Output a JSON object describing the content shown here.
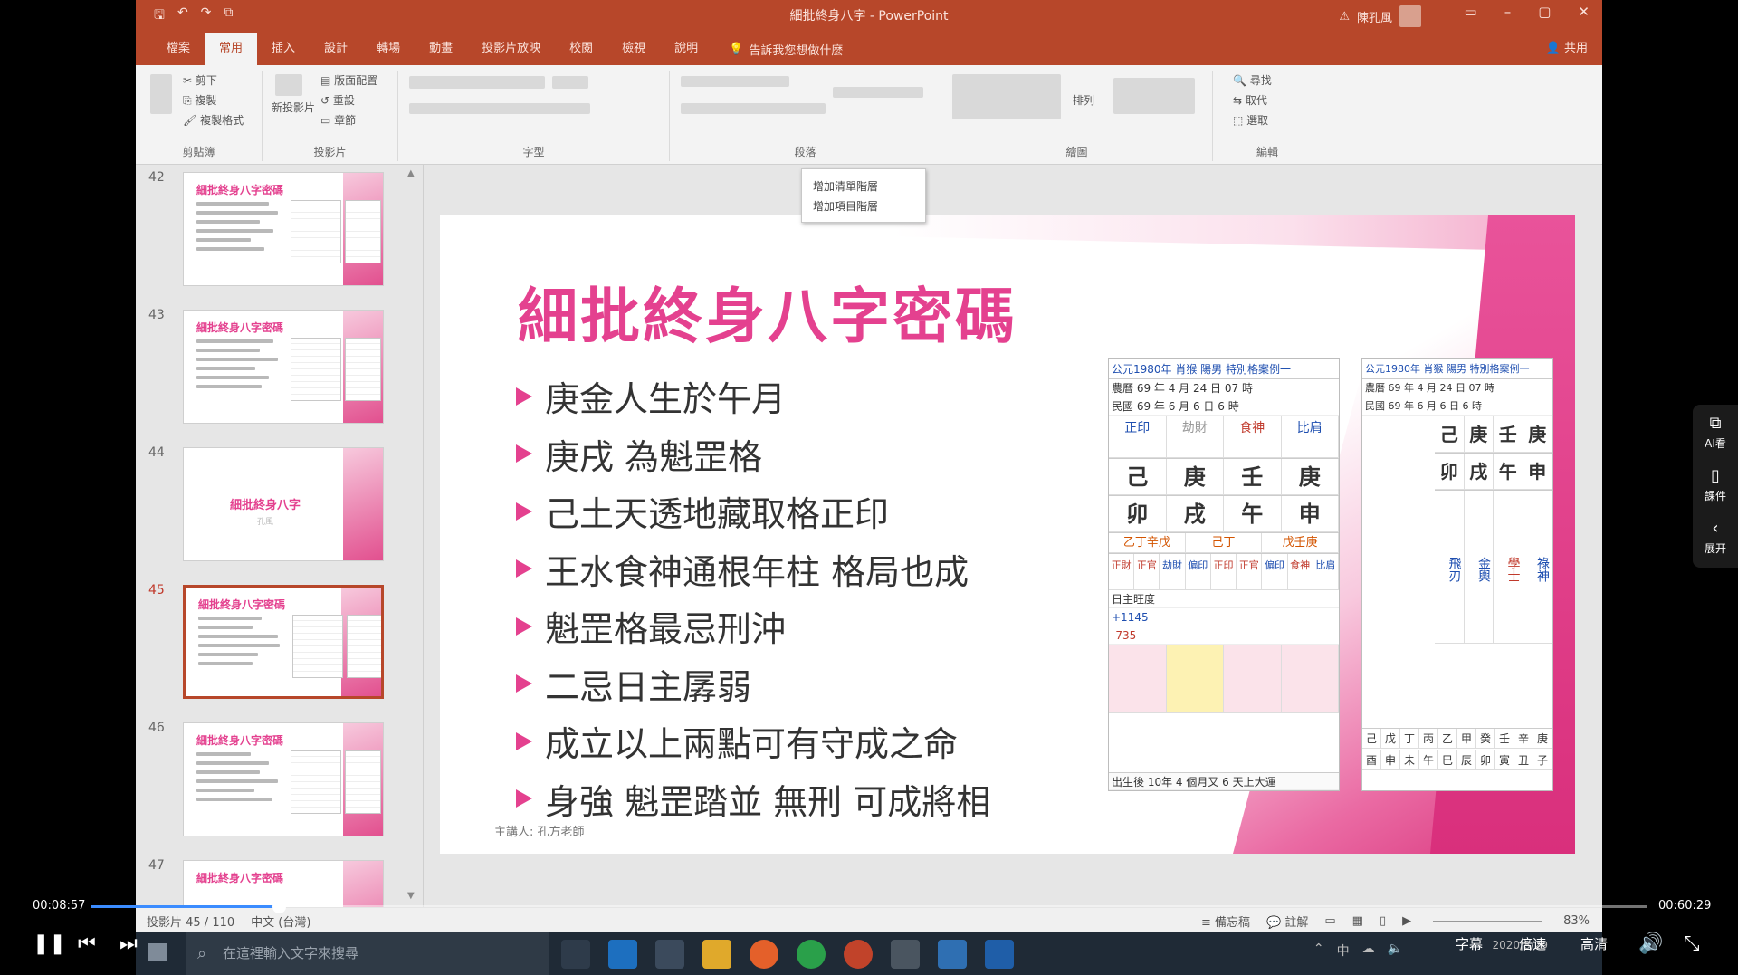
{
  "app": {
    "title": "細批終身八字 - PowerPoint",
    "user": "陳孔風",
    "share": "共用",
    "tell_me": "告訴我您想做什麼"
  },
  "tabs": [
    "檔案",
    "常用",
    "插入",
    "設計",
    "轉場",
    "動畫",
    "投影片放映",
    "校閱",
    "檢視",
    "說明"
  ],
  "ribbon": {
    "clipboard": {
      "label": "剪貼簿",
      "cut": "剪下",
      "copy": "複製",
      "format_painter": "複製格式"
    },
    "slides": {
      "label": "投影片",
      "new_slide": "新投影片",
      "layout": "版面配置",
      "reset": "重設",
      "section": "章節"
    },
    "font": {
      "label": "字型"
    },
    "paragraph": {
      "label": "段落"
    },
    "drawing": {
      "label": "繪圖",
      "arrange": "排列"
    },
    "editing": {
      "label": "編輯",
      "find": "尋找",
      "replace": "取代",
      "select": "選取"
    }
  },
  "tooltip": {
    "line1": "增加清單階層",
    "line2": "增加項目階層"
  },
  "thumbnails": [
    {
      "num": "42",
      "title": "細批終身八字密碼",
      "type": "content"
    },
    {
      "num": "43",
      "title": "細批終身八字密碼",
      "type": "content"
    },
    {
      "num": "44",
      "title": "細批終身八字",
      "subtitle": "孔風",
      "type": "section"
    },
    {
      "num": "45",
      "title": "細批終身八字密碼",
      "type": "content",
      "selected": true
    },
    {
      "num": "46",
      "title": "細批終身八字密碼",
      "type": "content"
    },
    {
      "num": "47",
      "title": "細批終身八字密碼",
      "type": "content"
    }
  ],
  "slide": {
    "title": "細批終身八字密碼",
    "bullets": [
      "庚金人生於午月",
      "庚戌 為魁罡格",
      "己土天透地藏取格正印",
      "王水食神通根年柱 格局也成",
      "魁罡格最忌刑沖",
      "二忌日主孱弱",
      "成立以上兩點可有守成之命",
      "身強 魁罡踏並 無刑 可成將相"
    ],
    "footer": "主講人: 孔方老師",
    "chart_left": {
      "header": "公元1980年 肖猴 陽男 特別格案例一",
      "row_lunar": "農曆 69 年 4 月 24 日 07 時",
      "row_minguo": "民國 69 年 6 月 6 日 6 時",
      "gods_top": [
        "正印",
        "劫財",
        "食神",
        "比肩"
      ],
      "stems": [
        "己",
        "庚",
        "壬",
        "庚"
      ],
      "branches": [
        "卯",
        "戌",
        "午",
        "申"
      ],
      "hidden": [
        "乙丁辛戊",
        "己丁",
        "戊壬庚"
      ],
      "hidden_gods": [
        "正財",
        "正官",
        "劫財",
        "偏印",
        "正印",
        "正官",
        "偏印",
        "食神",
        "比肩"
      ],
      "luck_label": "日主旺度",
      "luck_values": [
        "+1145",
        "-735"
      ],
      "bottom_text": "出生後 10年 4 個月又 6 天上大運"
    },
    "chart_right": {
      "header": "公元1980年 肖猴 陽男 特別格案例一",
      "row_lunar": "農曆 69 年 4 月 24 日 07 時",
      "row_minguo": "民國 69 年 6 月 6 日 6 時",
      "pillars_stem": [
        "己",
        "庚",
        "壬",
        "庚"
      ],
      "pillars_branch": [
        "卯",
        "戌",
        "午",
        "申"
      ],
      "shensha": [
        "飛刃",
        "金輿",
        "學士",
        "祿神"
      ],
      "luck_stems": [
        "己",
        "戊",
        "丁",
        "丙",
        "乙",
        "甲",
        "癸",
        "壬",
        "辛",
        "庚"
      ],
      "luck_branches": [
        "酉",
        "申",
        "未",
        "午",
        "巳",
        "辰",
        "卯",
        "寅",
        "丑",
        "子"
      ]
    }
  },
  "statusbar": {
    "slide_pos": "投影片 45 / 110",
    "language": "中文 (台灣)",
    "notes": "備忘稿",
    "comments": "註解",
    "zoom": "83%"
  },
  "taskbar": {
    "search_placeholder": "在這裡輸入文字來搜尋",
    "ime": "中",
    "date": "2020/8/29"
  },
  "player": {
    "current": "00:08:57",
    "total": "00:60:29",
    "progress": 0.121,
    "subtitles": "字幕",
    "speed": "倍速",
    "quality": "高清"
  },
  "side_panel": {
    "ai": "AI看",
    "courseware": "課件",
    "expand": "展开"
  },
  "colors": {
    "ppt_accent": "#b7472a",
    "slide_pink": "#e4418f",
    "progress_blue": "#3b8cff"
  }
}
